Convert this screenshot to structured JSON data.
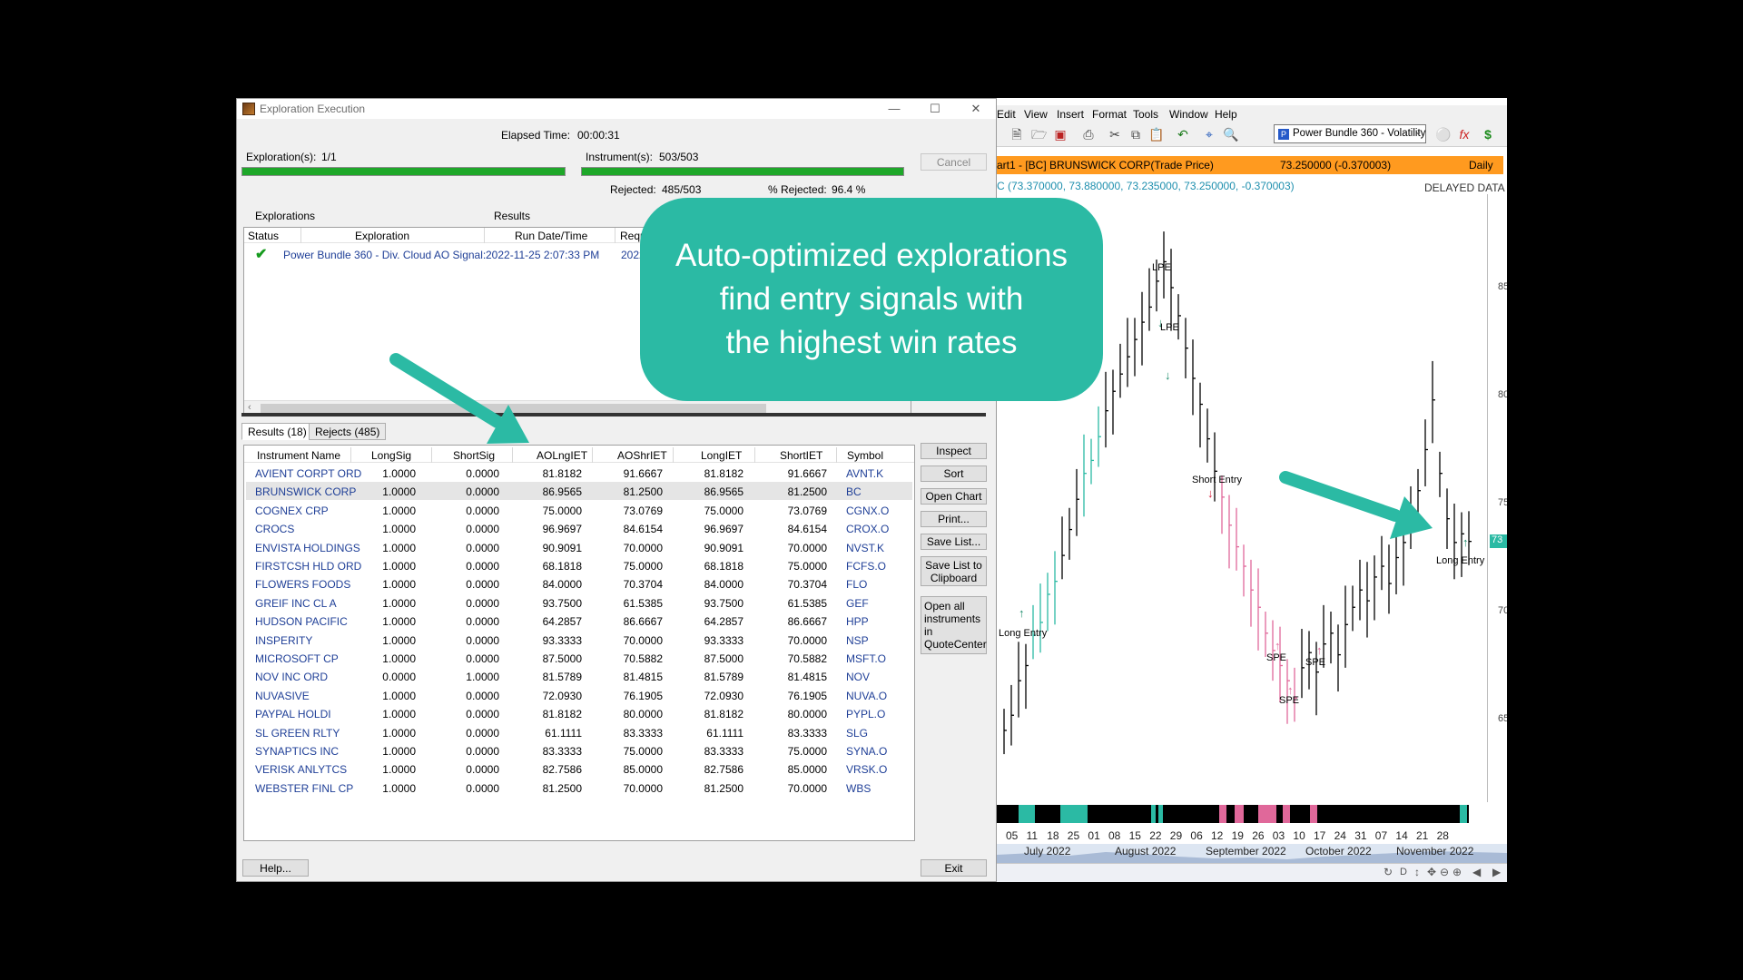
{
  "dialog": {
    "title": "Exploration Execution",
    "elapsed_label": "Elapsed Time:",
    "elapsed_value": "00:00:31",
    "explorations_label": "Exploration(s):",
    "explorations_value": "1/1",
    "instruments_label": "Instrument(s):",
    "instruments_value": "503/503",
    "rejected_label": "Rejected:",
    "rejected_value": "485/503",
    "pct_rejected_label": "% Rejected:",
    "pct_rejected_value": "96.4 %",
    "cancel_label": "Cancel",
    "explorations_section": "Explorations",
    "results_section": "Results",
    "exp_columns": [
      "Status",
      "Exploration",
      "Run Date/Time",
      "Reque"
    ],
    "exp_row": {
      "exploration": "Power Bundle 360 - Div. Cloud AO Signal:",
      "run_datetime": "2022-11-25 2:07:33 PM",
      "req": "2022"
    },
    "tab_results": "Results (18)",
    "tab_rejects": "Rejects (485)",
    "columns": [
      "Instrument Name",
      "LongSig",
      "ShortSig",
      "AOLngIET",
      "AOShrIET",
      "LongIET",
      "ShortIET",
      "Symbol"
    ],
    "rows": [
      [
        "AVIENT CORPT ORD",
        "1.0000",
        "0.0000",
        "81.8182",
        "91.6667",
        "81.8182",
        "91.6667",
        "AVNT.K"
      ],
      [
        "BRUNSWICK CORP",
        "1.0000",
        "0.0000",
        "86.9565",
        "81.2500",
        "86.9565",
        "81.2500",
        "BC"
      ],
      [
        "COGNEX CRP",
        "1.0000",
        "0.0000",
        "75.0000",
        "73.0769",
        "75.0000",
        "73.0769",
        "CGNX.O"
      ],
      [
        "CROCS",
        "1.0000",
        "0.0000",
        "96.9697",
        "84.6154",
        "96.9697",
        "84.6154",
        "CROX.O"
      ],
      [
        "ENVISTA HOLDINGS",
        "1.0000",
        "0.0000",
        "90.9091",
        "70.0000",
        "90.9091",
        "70.0000",
        "NVST.K"
      ],
      [
        "FIRSTCSH HLD ORD",
        "1.0000",
        "0.0000",
        "68.1818",
        "75.0000",
        "68.1818",
        "75.0000",
        "FCFS.O"
      ],
      [
        "FLOWERS FOODS",
        "1.0000",
        "0.0000",
        "84.0000",
        "70.3704",
        "84.0000",
        "70.3704",
        "FLO"
      ],
      [
        "GREIF INC CL A",
        "1.0000",
        "0.0000",
        "93.7500",
        "61.5385",
        "93.7500",
        "61.5385",
        "GEF"
      ],
      [
        "HUDSON PACIFIC",
        "1.0000",
        "0.0000",
        "64.2857",
        "86.6667",
        "64.2857",
        "86.6667",
        "HPP"
      ],
      [
        "INSPERITY",
        "1.0000",
        "0.0000",
        "93.3333",
        "70.0000",
        "93.3333",
        "70.0000",
        "NSP"
      ],
      [
        "MICROSOFT CP",
        "1.0000",
        "0.0000",
        "87.5000",
        "70.5882",
        "87.5000",
        "70.5882",
        "MSFT.O"
      ],
      [
        "NOV INC ORD",
        "0.0000",
        "1.0000",
        "81.5789",
        "81.4815",
        "81.5789",
        "81.4815",
        "NOV"
      ],
      [
        "NUVASIVE",
        "1.0000",
        "0.0000",
        "72.0930",
        "76.1905",
        "72.0930",
        "76.1905",
        "NUVA.O"
      ],
      [
        "PAYPAL HOLDI",
        "1.0000",
        "0.0000",
        "81.8182",
        "80.0000",
        "81.8182",
        "80.0000",
        "PYPL.O"
      ],
      [
        "SL GREEN RLTY",
        "1.0000",
        "0.0000",
        "61.1111",
        "83.3333",
        "61.1111",
        "83.3333",
        "SLG"
      ],
      [
        "SYNAPTICS INC",
        "1.0000",
        "0.0000",
        "83.3333",
        "75.0000",
        "83.3333",
        "75.0000",
        "SYNA.O"
      ],
      [
        "VERISK ANLYTCS",
        "1.0000",
        "0.0000",
        "82.7586",
        "85.0000",
        "82.7586",
        "85.0000",
        "VRSK.O"
      ],
      [
        "WEBSTER FINL CP",
        "1.0000",
        "0.0000",
        "81.2500",
        "70.0000",
        "81.2500",
        "70.0000",
        "WBS"
      ]
    ],
    "buttons": {
      "inspect": "Inspect",
      "sort": "Sort",
      "open_chart": "Open Chart",
      "print": "Print...",
      "save_list": "Save List...",
      "save_clipboard_1": "Save List to",
      "save_clipboard_2": "Clipboard",
      "open_all_1": "Open all",
      "open_all_2": "instruments",
      "open_all_3": "in",
      "open_all_4": "QuoteCenter",
      "help": "Help...",
      "exit": "Exit"
    }
  },
  "chart": {
    "menu": [
      "Edit",
      "View",
      "Insert",
      "Format",
      "Tools",
      "Window",
      "Help"
    ],
    "combo_value": "Power Bundle 360 - Volatility",
    "info_title": "art1 - [BC] BRUNSWICK CORP(Trade Price)",
    "info_price": "73.250000 (-0.370003)",
    "info_period": "Daily",
    "ohlc": "C (73.370000, 73.880000, 73.235000, 73.250000, -0.370003)",
    "delayed": "DELAYED DATA",
    "y_ticks": [
      "85",
      "80",
      "75",
      "73",
      "70",
      "65"
    ],
    "annotations": [
      "LPE",
      "LPE",
      "Short Entry",
      "Long Entry",
      "SPE",
      "SPE",
      "SPE",
      "Long Entry"
    ],
    "day_labels": [
      "05",
      "11",
      "18",
      "25",
      "01",
      "08",
      "15",
      "22",
      "29",
      "06",
      "12",
      "19",
      "26",
      "03",
      "10",
      "17",
      "24",
      "31",
      "07",
      "14",
      "21",
      "28"
    ],
    "month_labels": [
      "July 2022",
      "August 2022",
      "September 2022",
      "October 2022",
      "November 2022"
    ],
    "colors": {
      "up": "#2bbaa4",
      "down": "#e0689a",
      "bar": "#000000",
      "info_bar": "#ff9a1f"
    }
  },
  "callout": {
    "line1": "Auto-optimized explorations",
    "line2": "find entry signals with",
    "line3": "the highest win rates",
    "color": "#2bbaa4"
  }
}
